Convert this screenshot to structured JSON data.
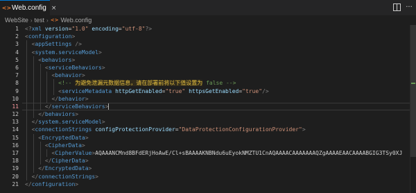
{
  "tab": {
    "label": "Web.config",
    "icon": "xml-file-icon",
    "close": "×"
  },
  "toolbar_icons": [
    "split-editor-icon",
    "more-actions-icon"
  ],
  "breadcrumb": {
    "items": [
      "WebSite",
      "test",
      "Web.config"
    ]
  },
  "cursor_line": 11,
  "line_numbers": [
    "1",
    "2",
    "3",
    "4",
    "5",
    "6",
    "7",
    "8",
    "9",
    "10",
    "11",
    "12",
    "13",
    "14",
    "15",
    "16",
    "17",
    "18",
    "19",
    "20",
    "21"
  ],
  "code": {
    "l1": [
      "<?",
      "xml",
      " ",
      "version",
      "=",
      "\"1.0\"",
      " ",
      "encoding",
      "=",
      "\"utf-8\"",
      "?>"
    ],
    "l2": [
      "<",
      "configuration",
      ">"
    ],
    "l3": [
      "<",
      "appSettings",
      " />"
    ],
    "l4": [
      "<",
      "system.serviceModel",
      ">"
    ],
    "l5": [
      "<",
      "behaviors",
      ">"
    ],
    "l6": [
      "<",
      "serviceBehaviors",
      ">"
    ],
    "l7": [
      "<",
      "behavior",
      ">"
    ],
    "l8_pre": "<!-- ",
    "l8_cjk": "为避免泄漏元数据信息，请在部署前将以下值设置为",
    "l8_post": " false -->",
    "l9": [
      "<",
      "serviceMetadata",
      " ",
      "httpGetEnabled",
      "=",
      "\"true\"",
      " ",
      "httpsGetEnabled",
      "=",
      "\"true\"",
      "/>"
    ],
    "l10": [
      "</",
      "behavior",
      ">"
    ],
    "l11": [
      "</",
      "serviceBehaviors",
      ">"
    ],
    "l12": [
      "</",
      "behaviors",
      ">"
    ],
    "l13": [
      "</",
      "system.serviceModel",
      ">"
    ],
    "l14": [
      "<",
      "connectionStrings",
      " ",
      "configProtectionProvider",
      "=",
      "\"DataProtectionConfigurationProvider\"",
      ">"
    ],
    "l15": [
      "<",
      "EncryptedData",
      ">"
    ],
    "l16": [
      "<",
      "CipherData",
      ">"
    ],
    "l17": [
      "<",
      "CipherValue",
      ">",
      "AQAAANCMnd8BFdERjHoAwE/Cl+sBAAAAKNBNdu6uEyokNMZTU1CnAQAAAACAAAAAAAQZgAAAAEAACAAAABGIG3TSy0XJ"
    ],
    "l18": [
      "</",
      "CipherData",
      ">"
    ],
    "l19": [
      "</",
      "EncryptedData",
      ">"
    ],
    "l20": [
      "</",
      "connectionStrings",
      ">"
    ],
    "l21": [
      "</",
      "configuration",
      ">"
    ]
  },
  "colors": {
    "tag": "#569cd6",
    "attr": "#9cdcfe",
    "string": "#ce9178",
    "comment": "#6a9955",
    "punct": "#808080"
  }
}
